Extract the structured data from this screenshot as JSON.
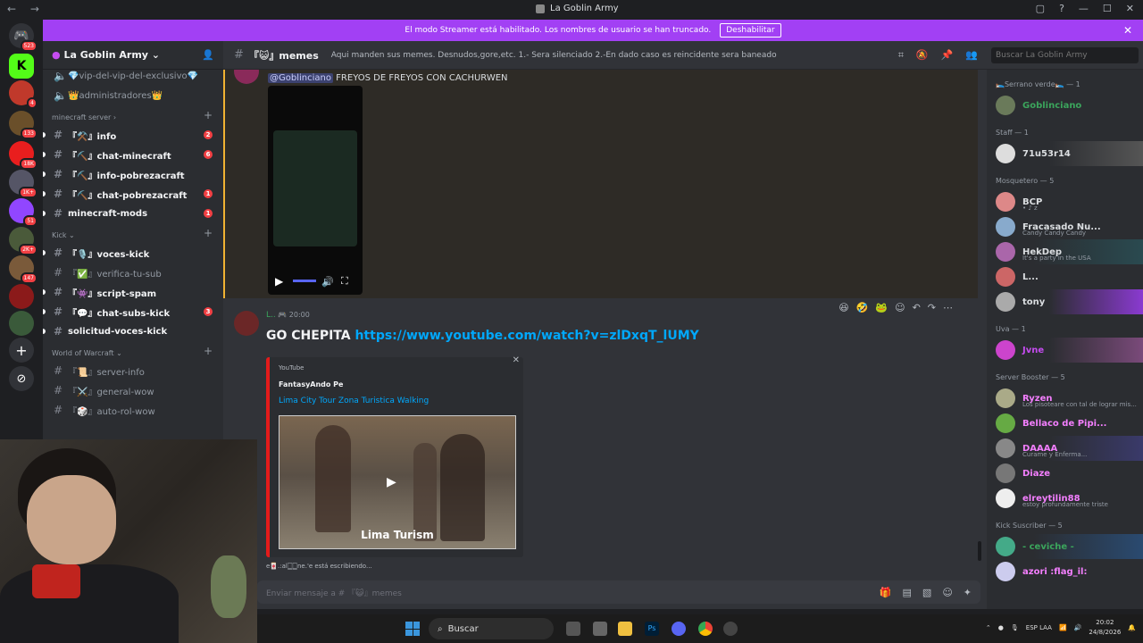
{
  "window": {
    "title": "La Goblin Army",
    "nav": "← →",
    "buttons": [
      "▢",
      "?",
      "—",
      "☐",
      "✕"
    ]
  },
  "banner": {
    "text": "El modo Streamer está habilitado. Los nombres de usuario se han truncado.",
    "button": "Deshabilitar",
    "close": "✕"
  },
  "servers": [
    {
      "label": "523"
    },
    {
      "label": "K"
    },
    {
      "label": "4"
    },
    {
      "label": "133"
    },
    {
      "label": "18K"
    },
    {
      "label": "1K+"
    },
    {
      "label": "51"
    },
    {
      "label": "2K+"
    },
    {
      "label": "147"
    },
    {
      "label": ""
    },
    {
      "label": ""
    },
    {
      "label": "+"
    },
    {
      "label": "⊘"
    }
  ],
  "server": {
    "name": "La Goblin Army"
  },
  "channels": {
    "top": [
      {
        "name": "💎vip-del-vip-del-exclusivo💎"
      },
      {
        "name": "👑administradores👑"
      }
    ],
    "categories": [
      {
        "name": "minecraft server",
        "items": [
          {
            "name": "『⚒️』info",
            "count": "2",
            "bright": true
          },
          {
            "name": "『⛏️』chat-minecraft",
            "count": "6",
            "bright": true
          },
          {
            "name": "『⛏️』info-pobrezacraft",
            "count": "",
            "bright": true
          },
          {
            "name": "『⛏️』chat-pobrezacraft",
            "count": "1",
            "bright": true
          },
          {
            "name": "minecraft-mods",
            "count": "1",
            "bright": true
          }
        ]
      },
      {
        "name": "Kick",
        "items": [
          {
            "name": "『🎙️』voces-kick",
            "count": "",
            "bright": true
          },
          {
            "name": "『✅』verifica-tu-sub",
            "count": "",
            "bright": false
          },
          {
            "name": "『👾』script-spam",
            "count": "",
            "bright": true
          },
          {
            "name": "『💬』chat-subs-kick",
            "count": "3",
            "bright": true
          },
          {
            "name": "solicitud-voces-kick",
            "count": "",
            "bright": true
          }
        ]
      },
      {
        "name": "World of Warcraft",
        "items": [
          {
            "name": "『📜』server-info",
            "count": "",
            "bright": false
          },
          {
            "name": "『⚔️』general-wow",
            "count": "",
            "bright": false
          },
          {
            "name": "『🎲』auto-rol-wow",
            "count": "",
            "bright": false
          }
        ]
      }
    ]
  },
  "chat_header": {
    "channel": "『😺』memes",
    "topic": "Aqui manden sus memes. Desnudos,gore,etc. 1.- Sera silenciado 2.-En dado caso es reincidente sera baneado"
  },
  "search": {
    "placeholder": "Buscar La Goblin Army"
  },
  "messages": {
    "m1": {
      "mention": "@Goblinciano",
      "text": "FREYOS DE FREYOS CON CACHURWEN"
    },
    "m2": {
      "author": "L..",
      "time": "20:00",
      "text": "GO CHEPITA ",
      "link": "https://www.youtube.com/watch?v=zlDxqT_lUMY",
      "embed": {
        "provider": "YouTube",
        "author": "FantasyAndo Pe",
        "title": "Lima City Tour  Zona Turistica Walking",
        "caption": "Lima Turism"
      }
    }
  },
  "typing": "e🀄.:al🀆🀆ne.'e está escribiendo...",
  "composer": {
    "placeholder": "Enviar mensaje a # 『😺』memes"
  },
  "members": [
    {
      "category": "🛌Serrano verde🛌 — 1",
      "users": [
        {
          "name": "Goblinciano",
          "color": "#3ba55c",
          "sub": ""
        }
      ]
    },
    {
      "category": "Staff — 1",
      "users": [
        {
          "name": "71u53r14",
          "color": "#f2f3f5",
          "sub": ""
        }
      ]
    },
    {
      "category": "Mosquetero — 5",
      "users": [
        {
          "name": "BCP",
          "color": "#f2f3f5",
          "sub": "• ♪ z"
        },
        {
          "name": "Fracasado Nu...",
          "color": "#f2f3f5",
          "sub": "Candy Candy Candy"
        },
        {
          "name": "HekDep",
          "color": "#f2f3f5",
          "sub": "It's a party in the USA"
        },
        {
          "name": "L...",
          "color": "#f2f3f5",
          "sub": ""
        },
        {
          "name": "tony",
          "color": "#f2f3f5",
          "sub": ""
        }
      ]
    },
    {
      "category": "Uva — 1",
      "users": [
        {
          "name": "Jvne",
          "color": "#c54cf0",
          "sub": ""
        }
      ]
    },
    {
      "category": "Server Booster — 5",
      "users": [
        {
          "name": "Ryzen",
          "color": "#f47fff",
          "sub": "Los pisoteare con tal de lograr mis..."
        },
        {
          "name": "Bellaco de Pipi...",
          "color": "#f47fff",
          "sub": ""
        },
        {
          "name": "DAAAA",
          "color": "#f47fff",
          "sub": "Curame y Enferma..."
        },
        {
          "name": "Diaze",
          "color": "#f47fff",
          "sub": ""
        },
        {
          "name": "elreytilin88",
          "color": "#f47fff",
          "sub": "estoy profundamente triste"
        }
      ]
    },
    {
      "category": "Kick Suscriber — 5",
      "users": [
        {
          "name": "- ceviche -",
          "color": "#3ba55c",
          "sub": ""
        },
        {
          "name": "azori :flag_il:",
          "color": "#f47fff",
          "sub": ""
        }
      ]
    }
  ],
  "taskbar": {
    "search": "Buscar",
    "lang": "ESP LAA",
    "time": "20:02",
    "date": "24/8/2026"
  },
  "colors": {
    "accent": "#a240f4",
    "bg": "#313338",
    "sidebar": "#2b2d31",
    "link": "#00a8fc"
  }
}
